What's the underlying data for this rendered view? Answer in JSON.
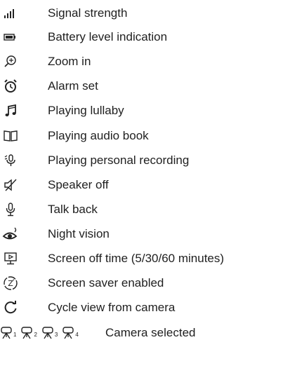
{
  "legend": {
    "items": [
      {
        "icon": "signal-strength-icon",
        "label": "Signal strength"
      },
      {
        "icon": "battery-icon",
        "label": "Battery level indication"
      },
      {
        "icon": "zoom-in-icon",
        "label": "Zoom in"
      },
      {
        "icon": "alarm-clock-icon",
        "label": "Alarm set"
      },
      {
        "icon": "music-note-icon",
        "label": "Playing lullaby"
      },
      {
        "icon": "open-book-icon",
        "label": "Playing audio book"
      },
      {
        "icon": "microphone-recording-icon",
        "label": "Playing personal recording"
      },
      {
        "icon": "speaker-off-icon",
        "label": "Speaker off"
      },
      {
        "icon": "microphone-icon",
        "label": "Talk back"
      },
      {
        "icon": "night-vision-eye-icon",
        "label": "Night vision"
      },
      {
        "icon": "screen-off-timer-icon",
        "label": "Screen off time (5/30/60 minutes)"
      },
      {
        "icon": "screen-saver-icon",
        "label": "Screen saver enabled"
      },
      {
        "icon": "cycle-view-icon",
        "label": "Cycle view from camera"
      },
      {
        "icon": "camera-select-icon",
        "label": "Camera selected"
      }
    ],
    "camera_numbers": [
      "1",
      "2",
      "3",
      "4"
    ]
  }
}
